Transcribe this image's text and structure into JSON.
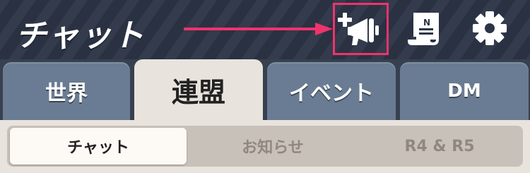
{
  "header": {
    "title": "チャット",
    "icons": {
      "announcement": "megaphone-plus-icon",
      "notes": "note-scroll-icon",
      "settings": "gear-icon"
    },
    "highlight_color": "#f0336a"
  },
  "tabs": [
    {
      "label": "世界",
      "active": false
    },
    {
      "label": "連盟",
      "active": true
    },
    {
      "label": "イベント",
      "active": false
    },
    {
      "label": "DM",
      "active": false
    }
  ],
  "subtabs": [
    {
      "label": "チャット",
      "active": true
    },
    {
      "label": "お知らせ",
      "active": false
    },
    {
      "label": "R4 & R5",
      "active": false
    }
  ]
}
